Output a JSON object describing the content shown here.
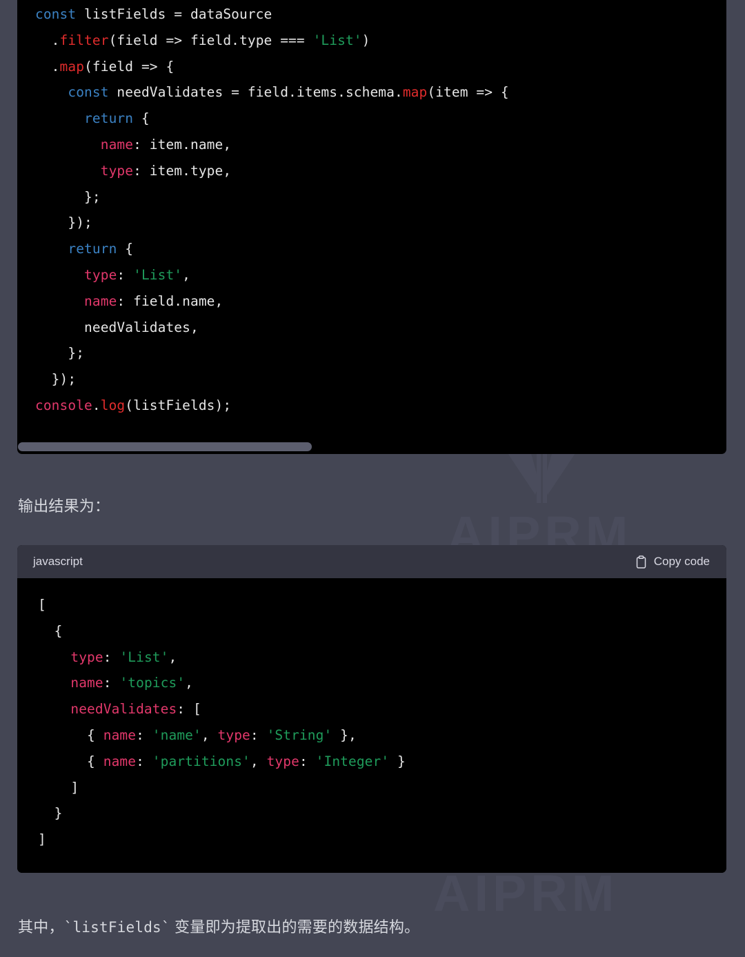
{
  "colors": {
    "page_background": "#444654",
    "code_background": "#000000",
    "code_header_background": "#343541",
    "keyword": "#3b82c4",
    "function": "#e02c2c",
    "property": "#e2386b",
    "string": "#1f9c5b",
    "plain_text": "#e6e6e6",
    "body_text": "#d6d8de",
    "scrollbar_thumb": "#5c5e6e",
    "watermark": "#4a4c5c"
  },
  "watermark": {
    "text_top": "AIPRM",
    "text_bottom": "AIPRM",
    "logo_name": "aiprm-logo"
  },
  "top_code_block": {
    "lines": [
      [
        {
          "t": "const",
          "c": "k"
        },
        {
          "t": " listFields = dataSource",
          "c": "pl"
        }
      ],
      [
        {
          "t": "  .",
          "c": "pl"
        },
        {
          "t": "filter",
          "c": "fn"
        },
        {
          "t": "(field => field.type === ",
          "c": "pl"
        },
        {
          "t": "'List'",
          "c": "str"
        },
        {
          "t": ")",
          "c": "pl"
        }
      ],
      [
        {
          "t": "  .",
          "c": "pl"
        },
        {
          "t": "map",
          "c": "fn"
        },
        {
          "t": "(field => {",
          "c": "pl"
        }
      ],
      [
        {
          "t": "    ",
          "c": "pl"
        },
        {
          "t": "const",
          "c": "k"
        },
        {
          "t": " needValidates = field.items.schema.",
          "c": "pl"
        },
        {
          "t": "map",
          "c": "fn"
        },
        {
          "t": "(item => {",
          "c": "pl"
        }
      ],
      [
        {
          "t": "      ",
          "c": "pl"
        },
        {
          "t": "return",
          "c": "k"
        },
        {
          "t": " {",
          "c": "pl"
        }
      ],
      [
        {
          "t": "        ",
          "c": "pl"
        },
        {
          "t": "name",
          "c": "pk"
        },
        {
          "t": ": item.name,",
          "c": "pl"
        }
      ],
      [
        {
          "t": "        ",
          "c": "pl"
        },
        {
          "t": "type",
          "c": "pk"
        },
        {
          "t": ": item.type,",
          "c": "pl"
        }
      ],
      [
        {
          "t": "      };",
          "c": "pl"
        }
      ],
      [
        {
          "t": "    });",
          "c": "pl"
        }
      ],
      [
        {
          "t": "    ",
          "c": "pl"
        },
        {
          "t": "return",
          "c": "k"
        },
        {
          "t": " {",
          "c": "pl"
        }
      ],
      [
        {
          "t": "      ",
          "c": "pl"
        },
        {
          "t": "type",
          "c": "pk"
        },
        {
          "t": ": ",
          "c": "pl"
        },
        {
          "t": "'List'",
          "c": "str"
        },
        {
          "t": ",",
          "c": "pl"
        }
      ],
      [
        {
          "t": "      ",
          "c": "pl"
        },
        {
          "t": "name",
          "c": "pk"
        },
        {
          "t": ": field.name,",
          "c": "pl"
        }
      ],
      [
        {
          "t": "      needValidates,",
          "c": "pl"
        }
      ],
      [
        {
          "t": "    };",
          "c": "pl"
        }
      ],
      [
        {
          "t": "  });",
          "c": "pl"
        }
      ],
      [
        {
          "t": "console",
          "c": "cs"
        },
        {
          "t": ".",
          "c": "pl"
        },
        {
          "t": "log",
          "c": "fn"
        },
        {
          "t": "(listFields);",
          "c": "pl"
        }
      ]
    ]
  },
  "paragraph_1": "输出结果为：",
  "output_code_block": {
    "language": "javascript",
    "copy_label": "Copy code",
    "copy_icon": "clipboard-icon",
    "lines": [
      [
        {
          "t": "[",
          "c": "pl"
        }
      ],
      [
        {
          "t": "  {",
          "c": "pl"
        }
      ],
      [
        {
          "t": "    ",
          "c": "pl"
        },
        {
          "t": "type",
          "c": "pk"
        },
        {
          "t": ": ",
          "c": "pl"
        },
        {
          "t": "'List'",
          "c": "str"
        },
        {
          "t": ",",
          "c": "pl"
        }
      ],
      [
        {
          "t": "    ",
          "c": "pl"
        },
        {
          "t": "name",
          "c": "pk"
        },
        {
          "t": ": ",
          "c": "pl"
        },
        {
          "t": "'topics'",
          "c": "str"
        },
        {
          "t": ",",
          "c": "pl"
        }
      ],
      [
        {
          "t": "    ",
          "c": "pl"
        },
        {
          "t": "needValidates",
          "c": "pk"
        },
        {
          "t": ": [",
          "c": "pl"
        }
      ],
      [
        {
          "t": "      { ",
          "c": "pl"
        },
        {
          "t": "name",
          "c": "pk"
        },
        {
          "t": ": ",
          "c": "pl"
        },
        {
          "t": "'name'",
          "c": "str"
        },
        {
          "t": ", ",
          "c": "pl"
        },
        {
          "t": "type",
          "c": "pk"
        },
        {
          "t": ": ",
          "c": "pl"
        },
        {
          "t": "'String'",
          "c": "str"
        },
        {
          "t": " },",
          "c": "pl"
        }
      ],
      [
        {
          "t": "      { ",
          "c": "pl"
        },
        {
          "t": "name",
          "c": "pk"
        },
        {
          "t": ": ",
          "c": "pl"
        },
        {
          "t": "'partitions'",
          "c": "str"
        },
        {
          "t": ", ",
          "c": "pl"
        },
        {
          "t": "type",
          "c": "pk"
        },
        {
          "t": ": ",
          "c": "pl"
        },
        {
          "t": "'Integer'",
          "c": "str"
        },
        {
          "t": " }",
          "c": "pl"
        }
      ],
      [
        {
          "t": "    ]",
          "c": "pl"
        }
      ],
      [
        {
          "t": "  }",
          "c": "pl"
        }
      ],
      [
        {
          "t": "]",
          "c": "pl"
        }
      ]
    ]
  },
  "paragraph_2": {
    "prefix": "其中，",
    "code": "`listFields`",
    "suffix": " 变量即为提取出的需要的数据结构。"
  }
}
